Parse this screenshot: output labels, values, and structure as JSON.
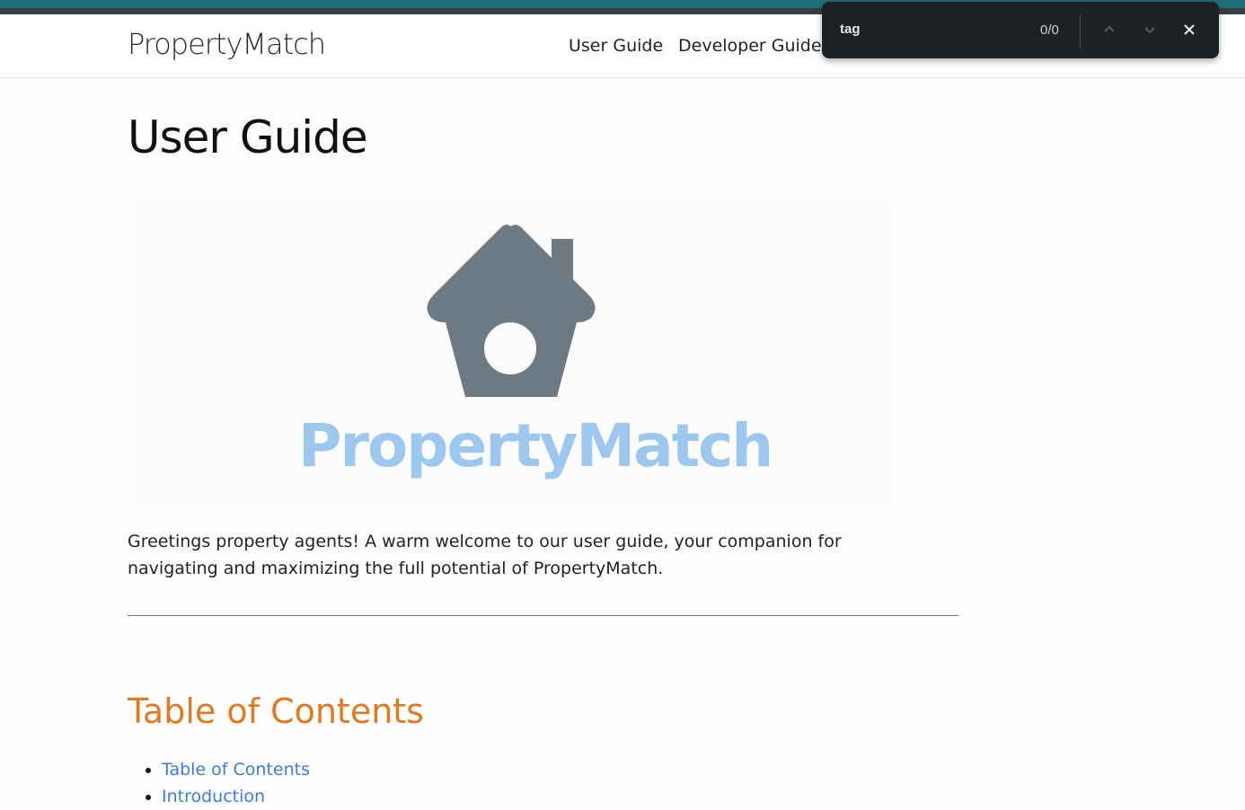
{
  "navbar": {
    "brand": "PropertyMatch",
    "links": [
      "User Guide",
      "Developer Guide"
    ]
  },
  "main": {
    "title": "User Guide",
    "logo_text": "PropertyMatch",
    "intro": "Greetings property agents! A warm welcome to our user guide, your companion for navigating and maximizing the full potential of PropertyMatch.",
    "toc_title": "Table of Contents",
    "toc_items": [
      "Table of Contents",
      "Introduction"
    ]
  },
  "find_bar": {
    "query": "tag",
    "count": "0/0"
  },
  "colors": {
    "accent": "#e07a22",
    "link": "#3b7dd8",
    "logo_house": "#6e7a83",
    "logo_text": "#9cc7ee"
  }
}
